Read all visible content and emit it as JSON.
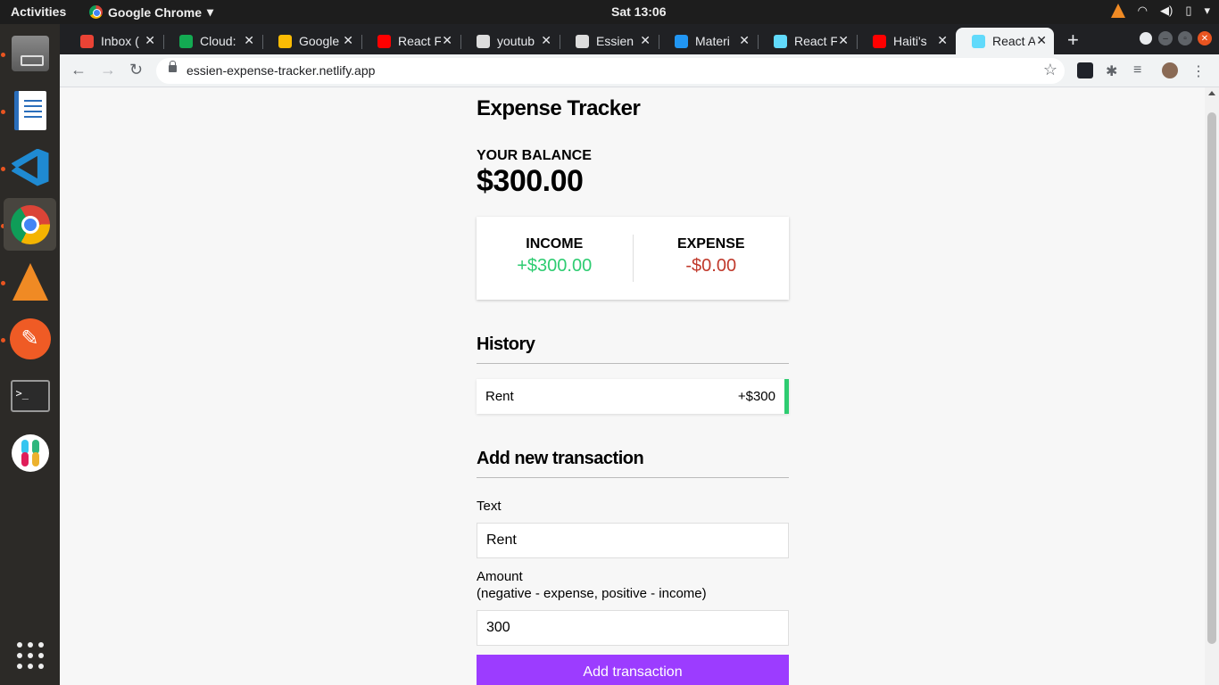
{
  "system_bar": {
    "activities": "Activities",
    "app_name": "Google Chrome",
    "clock": "Sat 13:06"
  },
  "dock": {
    "items": [
      "files-icon",
      "libreoffice-writer-icon",
      "vscode-icon",
      "chrome-icon",
      "vlc-icon",
      "postman-icon",
      "terminal-icon",
      "slack-icon",
      "show-apps-icon"
    ]
  },
  "browser": {
    "tabs": [
      {
        "label": "Inbox (",
        "favicon_color": "#ea4335"
      },
      {
        "label": "Cloud:",
        "favicon_color": "#13aa52"
      },
      {
        "label": "Google",
        "favicon_color": "#fbbc04"
      },
      {
        "label": "React F",
        "favicon_color": "#ff0000"
      },
      {
        "label": "youtub",
        "favicon_color": "#dddddd"
      },
      {
        "label": "Essien",
        "favicon_color": "#dddddd"
      },
      {
        "label": "Materi",
        "favicon_color": "#2196f3"
      },
      {
        "label": "React F",
        "favicon_color": "#61dafb"
      },
      {
        "label": "Haiti's",
        "favicon_color": "#ff0000"
      },
      {
        "label": "React A",
        "favicon_color": "#61dafb"
      }
    ],
    "new_tab": "+",
    "url": "essien-expense-tracker.netlify.app"
  },
  "app": {
    "title": "Expense Tracker",
    "balance_label": "YOUR BALANCE",
    "balance_value": "$300.00",
    "income_label": "INCOME",
    "income_value": "+$300.00",
    "expense_label": "EXPENSE",
    "expense_value": "-$0.00",
    "history_title": "History",
    "history": [
      {
        "text": "Rent",
        "amount": "+$300"
      }
    ],
    "form_title": "Add new transaction",
    "text_label": "Text",
    "text_value": "Rent",
    "amount_label": "Amount",
    "amount_hint": "(negative - expense, positive - income)",
    "amount_value": "300",
    "submit_label": "Add transaction"
  },
  "colors": {
    "income": "#2ecc71",
    "expense": "#c0392b",
    "button": "#9c3cff"
  }
}
